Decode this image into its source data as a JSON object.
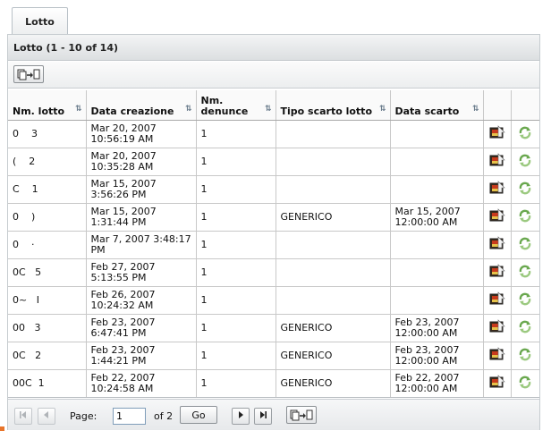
{
  "tab": {
    "label": "Lotto"
  },
  "panel": {
    "title": "Lotto (1 - 10 of 14)"
  },
  "columns": [
    {
      "label": "Nm. lotto",
      "sortable": true
    },
    {
      "label": "Data creazione",
      "sortable": true
    },
    {
      "label": "Nm. denunce",
      "sortable": true
    },
    {
      "label": "Tipo scarto lotto",
      "sortable": true
    },
    {
      "label": "Data scarto",
      "sortable": true
    }
  ],
  "rows": [
    {
      "lotto": "0    3",
      "creazione": "Mar 20, 2007 10:56:19 AM",
      "denunce": "1",
      "tipo": "",
      "scarto": ""
    },
    {
      "lotto": "(    2",
      "creazione": "Mar 20, 2007 10:35:28 AM",
      "denunce": "1",
      "tipo": "",
      "scarto": ""
    },
    {
      "lotto": "C    1",
      "creazione": "Mar 15, 2007 3:56:26 PM",
      "denunce": "1",
      "tipo": "",
      "scarto": ""
    },
    {
      "lotto": "0    )",
      "creazione": "Mar 15, 2007 1:31:44 PM",
      "denunce": "1",
      "tipo": "GENERICO",
      "scarto": "Mar 15, 2007 12:00:00 AM"
    },
    {
      "lotto": "0    ·",
      "creazione": "Mar 7, 2007 3:48:17 PM",
      "denunce": "1",
      "tipo": "",
      "scarto": ""
    },
    {
      "lotto": "0C   5",
      "creazione": "Feb 27, 2007 5:13:55 PM",
      "denunce": "1",
      "tipo": "",
      "scarto": ""
    },
    {
      "lotto": "0~   I",
      "creazione": "Feb 26, 2007 10:24:32 AM",
      "denunce": "1",
      "tipo": "",
      "scarto": ""
    },
    {
      "lotto": "00   3",
      "creazione": "Feb 23, 2007 6:47:41 PM",
      "denunce": "1",
      "tipo": "GENERICO",
      "scarto": "Feb 23, 2007 12:00:00 AM"
    },
    {
      "lotto": "0C   2",
      "creazione": "Feb 23, 2007 1:44:21 PM",
      "denunce": "1",
      "tipo": "GENERICO",
      "scarto": "Feb 23, 2007 12:00:00 AM"
    },
    {
      "lotto": "00C  1",
      "creazione": "Feb 22, 2007 10:24:58 AM",
      "denunce": "1",
      "tipo": "GENERICO",
      "scarto": "Feb 22, 2007 12:00:00 AM"
    }
  ],
  "row_icons": {
    "detail": "detail-icon",
    "refresh": "refresh-icon"
  },
  "pager": {
    "page_label": "Page:",
    "page_value": "1",
    "of_label": "of 2",
    "go_label": "Go"
  },
  "icons": {
    "export": "export-icon",
    "first": "first-page-icon",
    "prev": "prev-page-icon",
    "next": "next-page-icon",
    "last": "last-page-icon"
  },
  "colors": {
    "accent_orange": "#e8742a",
    "refresh_green": "#6aa84f"
  }
}
